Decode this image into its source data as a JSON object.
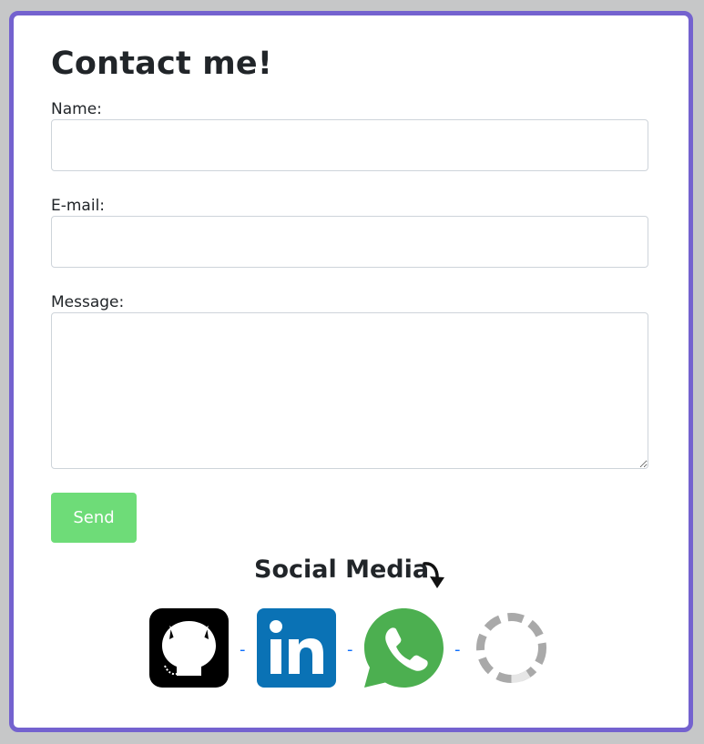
{
  "form": {
    "title": "Contact me!",
    "name_label": "Name:",
    "name_value": "",
    "email_label": "E-mail:",
    "email_value": "",
    "message_label": "Message:",
    "message_value": "",
    "send_label": "Send"
  },
  "social": {
    "title": "Social Media",
    "separator": "-",
    "items": [
      {
        "icon": "github-icon"
      },
      {
        "icon": "linkedin-icon"
      },
      {
        "icon": "whatsapp-icon"
      },
      {
        "icon": "loading-spinner-icon"
      }
    ]
  },
  "colors": {
    "card_border": "#7462cf",
    "send_button": "#6edc78",
    "linkedin": "#0a66c2",
    "whatsapp": "#4caf50"
  }
}
